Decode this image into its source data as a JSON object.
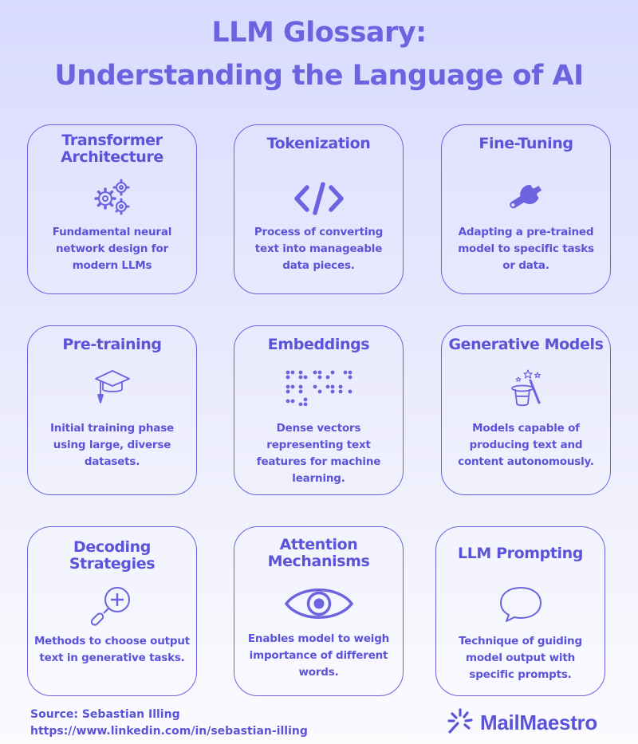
{
  "title_line1": "LLM Glossary:",
  "title_line2": "Understanding the Language of AI",
  "cards": [
    {
      "title_lines": [
        "Transformer",
        "Architecture"
      ],
      "icon": "gears-icon",
      "desc_lines": [
        "Fundamental neural",
        "network design for",
        "modern LLMs"
      ]
    },
    {
      "title_lines": [
        "Tokenization"
      ],
      "icon": "code-brackets-icon",
      "desc_lines": [
        "Process of converting",
        "text into manageable",
        "data pieces."
      ]
    },
    {
      "title_lines": [
        "Fine-Tuning"
      ],
      "icon": "wrench-icon",
      "desc_lines": [
        "Adapting a pre-trained",
        "model to specific tasks",
        "or data."
      ]
    },
    {
      "title_lines": [
        "Pre-training"
      ],
      "icon": "graduation-cap-icon",
      "desc_lines": [
        "Initial training phase",
        "using large, diverse",
        "datasets."
      ]
    },
    {
      "title_lines": [
        "Embeddings"
      ],
      "icon": "braille-icon",
      "desc_lines": [
        "Dense vectors",
        "representing text",
        "features for machine",
        "learning."
      ]
    },
    {
      "title_lines": [
        "Generative Models"
      ],
      "icon": "magic-hat-icon",
      "desc_lines": [
        "Models capable of",
        "producing text and",
        "content autonomously."
      ]
    },
    {
      "title_lines": [
        "Decoding",
        "Strategies"
      ],
      "icon": "magnifier-plus-icon",
      "desc_lines": [
        "Methods to choose output",
        "text in generative tasks."
      ]
    },
    {
      "title_lines": [
        "Attention",
        "Mechanisms"
      ],
      "icon": "eye-icon",
      "desc_lines": [
        "Enables model to weigh",
        "importance of different",
        "words."
      ]
    },
    {
      "title_lines": [
        "LLM Prompting"
      ],
      "icon": "speech-bubble-icon",
      "desc_lines": [
        "Technique of guiding",
        "model output with",
        "specific prompts."
      ]
    }
  ],
  "footer": {
    "source": "Source: Sebastian Illing",
    "url": "https://www.linkedin.com/in/sebastian-illing",
    "logo_text": "MailMaestro",
    "logo_icon": "sparkle-burst-icon"
  },
  "colors": {
    "accent": "#6b63e0",
    "text": "#5b53d8"
  }
}
